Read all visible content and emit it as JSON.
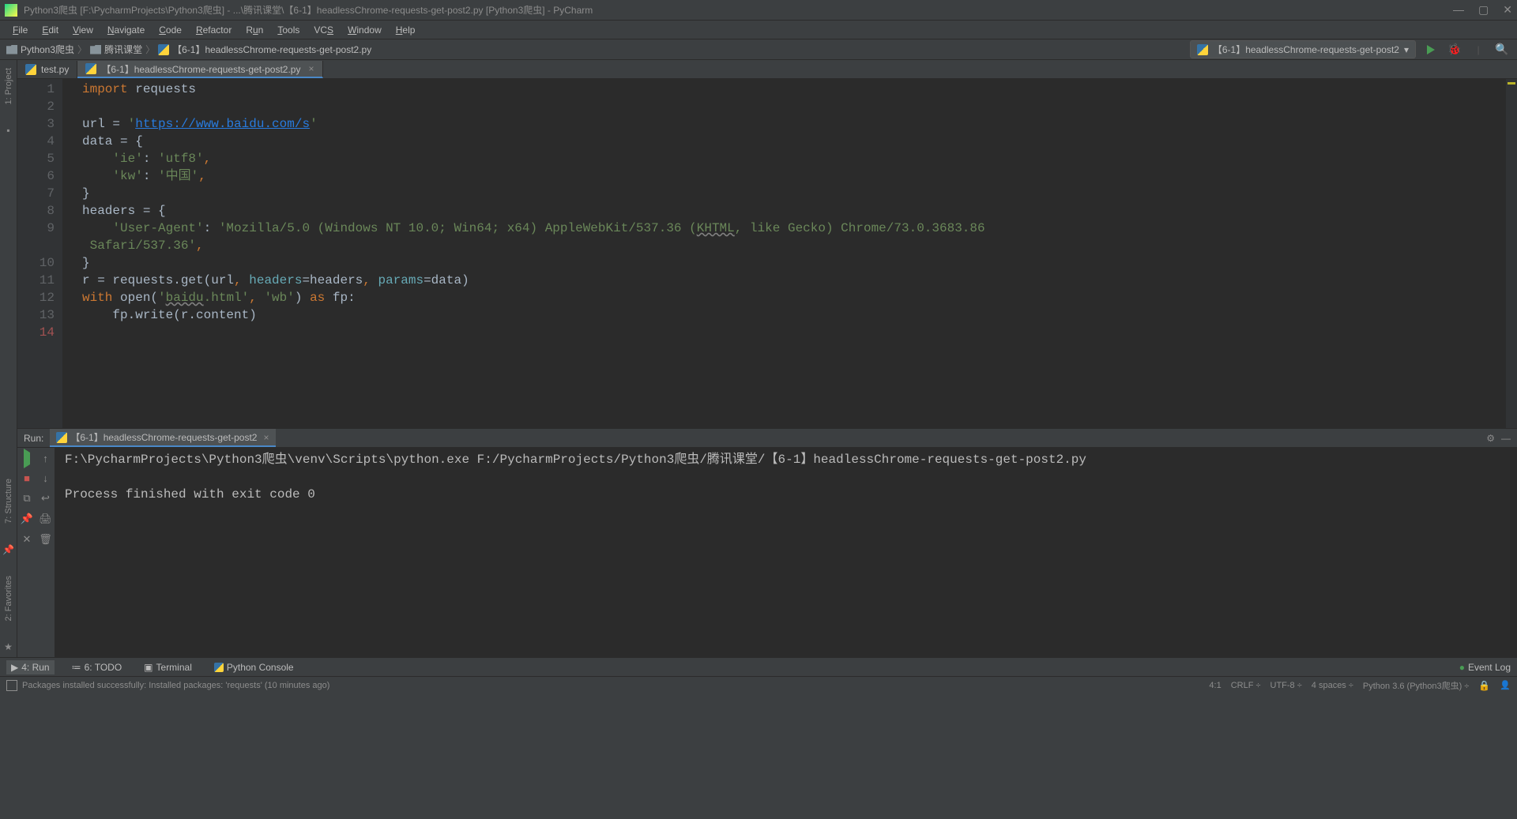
{
  "title": "Python3爬虫 [F:\\PycharmProjects\\Python3爬虫] - ...\\腾讯课堂\\【6-1】headlessChrome-requests-get-post2.py [Python3爬虫] - PyCharm",
  "menu": {
    "file": "File",
    "edit": "Edit",
    "view": "View",
    "navigate": "Navigate",
    "code": "Code",
    "refactor": "Refactor",
    "run": "Run",
    "tools": "Tools",
    "vcs": "VCS",
    "window": "Window",
    "help": "Help"
  },
  "breadcrumbs": {
    "p1": "Python3爬虫",
    "p2": "腾讯课堂",
    "p3": "【6-1】headlessChrome-requests-get-post2.py"
  },
  "run_config": "【6-1】headlessChrome-requests-get-post2",
  "tabs": {
    "t1": "test.py",
    "t2": "【6-1】headlessChrome-requests-get-post2.py"
  },
  "side": {
    "project": "1: Project",
    "structure": "7: Structure",
    "favorites": "2: Favorites"
  },
  "code": {
    "l1a": "import",
    "l1b": " requests",
    "l3a": "url = ",
    "l3b": "'",
    "l3c": "https://www.baidu.com/s",
    "l3d": "'",
    "l4": "data = {",
    "l5a": "    ",
    "l5b": "'ie'",
    "l5c": ": ",
    "l5d": "'utf8'",
    "l5e": ",",
    "l6a": "    ",
    "l6b": "'kw'",
    "l6c": ": ",
    "l6d": "'中国'",
    "l6e": ",",
    "l7": "}",
    "l8": "headers = {",
    "l9a": "    ",
    "l9b": "'User-Agent'",
    "l9c": ": ",
    "l9d": "'Mozilla/5.0 (Windows NT 10.0; Win64; x64) AppleWebKit/537.36 (",
    "l9e": "KHTML",
    "l9f": ", like Gecko) Chrome/73.0.3683.86 ",
    "l9g": "Safari/537.36'",
    "l9h": ",",
    "l10": "}",
    "l11a": "r = requests.get(url",
    "l11b": ", ",
    "l11c": "headers",
    "l11d": "=headers",
    "l11e": ", ",
    "l11f": "params",
    "l11g": "=data)",
    "l12a": "with",
    "l12b": " open(",
    "l12c": "'",
    "l12d": "baidu",
    "l12e": ".html'",
    "l12f": ", ",
    "l12g": "'wb'",
    "l12h": ") ",
    "l12i": "as",
    "l12j": " fp:",
    "l13": "    fp.write(r.content)"
  },
  "lines": {
    "l1": "1",
    "l2": "2",
    "l3": "3",
    "l4": "4",
    "l5": "5",
    "l6": "6",
    "l7": "7",
    "l8": "8",
    "l9": "9",
    "l10": "10",
    "l11": "11",
    "l12": "12",
    "l13": "13",
    "l14": "14"
  },
  "run": {
    "label": "Run:",
    "tab": "【6-1】headlessChrome-requests-get-post2",
    "out1": "F:\\PycharmProjects\\Python3爬虫\\venv\\Scripts\\python.exe F:/PycharmProjects/Python3爬虫/腾讯课堂/【6-1】headlessChrome-requests-get-post2.py",
    "out3": "Process finished with exit code 0"
  },
  "tools": {
    "run": "4: Run",
    "todo": "6: TODO",
    "terminal": "Terminal",
    "python_console": "Python Console",
    "event_log": "Event Log"
  },
  "status": {
    "msg": "Packages installed successfully: Installed packages: 'requests' (10 minutes ago)",
    "pos": "4:1",
    "crlf": "CRLF",
    "enc": "UTF-8",
    "indent": "4 spaces",
    "interpreter": "Python 3.6 (Python3爬虫)"
  }
}
